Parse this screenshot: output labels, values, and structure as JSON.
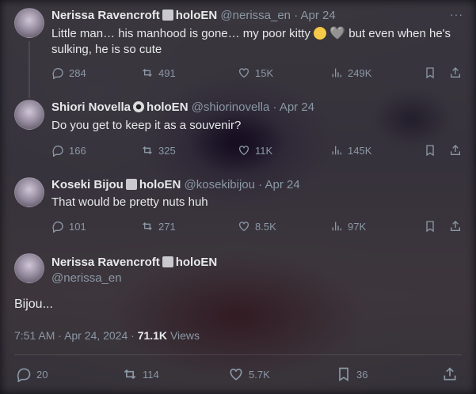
{
  "colors": {
    "text": "#e7e9ea",
    "muted": "#8b98a5",
    "thread_line": "#4a4a52"
  },
  "tweets": [
    {
      "name": "Nerissa Ravencroft",
      "badge_icon": "book-emoji-icon",
      "org": "holoEN",
      "handle": "@nerissa_en",
      "dot": "·",
      "date": "Apr 24",
      "text_before": "Little man… his manhood is gone… my poor kitty ",
      "text_after": " but even when he's sulking, he is so cute",
      "emoji_1": "crying-face-emoji-icon",
      "emoji_2": "🩶",
      "replies": "284",
      "reposts": "491",
      "likes": "15K",
      "views": "249K"
    },
    {
      "name": "Shiori Novella",
      "badge_icon": "eye-emoji-icon",
      "org": "holoEN",
      "handle": "@shiorinovella",
      "dot": "·",
      "date": "Apr 24",
      "text": "Do you get to keep it as a souvenir?",
      "replies": "166",
      "reposts": "325",
      "likes": "11K",
      "views": "145K"
    },
    {
      "name": "Koseki Bijou",
      "badge_icon": "moai-emoji-icon",
      "org": "holoEN",
      "handle": "@kosekibijou",
      "dot": "·",
      "date": "Apr 24",
      "text": "That would be pretty nuts huh",
      "replies": "101",
      "reposts": "271",
      "likes": "8.5K",
      "views": "97K"
    }
  ],
  "main_tweet": {
    "name": "Nerissa Ravencroft",
    "org": "holoEN",
    "handle": "@nerissa_en",
    "text": "Bijou...",
    "time": "7:51 AM",
    "dot": "·",
    "date": "Apr 24, 2024",
    "views_count": "71.1K",
    "views_label": "Views",
    "replies": "20",
    "reposts": "114",
    "likes": "5.7K",
    "bookmarks": "36"
  },
  "more_label": "···"
}
